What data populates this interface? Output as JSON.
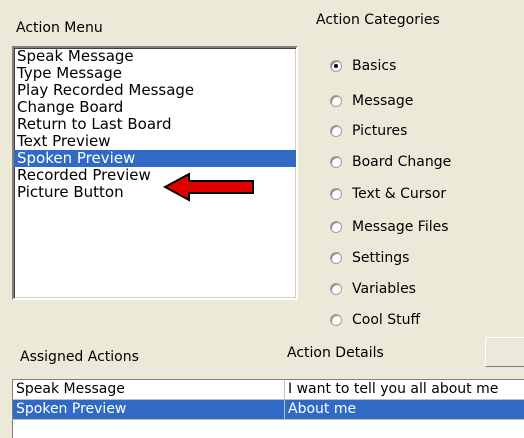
{
  "action_menu": {
    "title": "Action Menu",
    "items": [
      {
        "label": "Speak Message"
      },
      {
        "label": "Type Message"
      },
      {
        "label": "Play Recorded Message"
      },
      {
        "label": "Change Board"
      },
      {
        "label": "Return to Last Board"
      },
      {
        "label": "Text Preview"
      },
      {
        "label": "Spoken Preview"
      },
      {
        "label": "Recorded Preview"
      },
      {
        "label": "Picture Button"
      }
    ],
    "selected_item": "Spoken Preview"
  },
  "action_categories": {
    "title": "Action Categories",
    "options": [
      {
        "label": "Basics",
        "checked": true
      },
      {
        "label": "Message",
        "checked": false
      },
      {
        "label": "Pictures",
        "checked": false
      },
      {
        "label": "Board Change",
        "checked": false
      },
      {
        "label": "Text & Cursor",
        "checked": false
      },
      {
        "label": "Message Files",
        "checked": false
      },
      {
        "label": "Settings",
        "checked": false
      },
      {
        "label": "Variables",
        "checked": false
      },
      {
        "label": "Cool Stuff",
        "checked": false
      }
    ]
  },
  "assigned_actions": {
    "title": "Assigned Actions",
    "details_title": "Action Details",
    "rows": [
      {
        "action": "Speak Message",
        "details": "I want to tell you all about me"
      },
      {
        "action": "Spoken Preview",
        "details": "About me"
      }
    ]
  },
  "colors": {
    "selection": "#316ac5",
    "arrow": "#e00000",
    "window_bg": "#ece9d8"
  }
}
